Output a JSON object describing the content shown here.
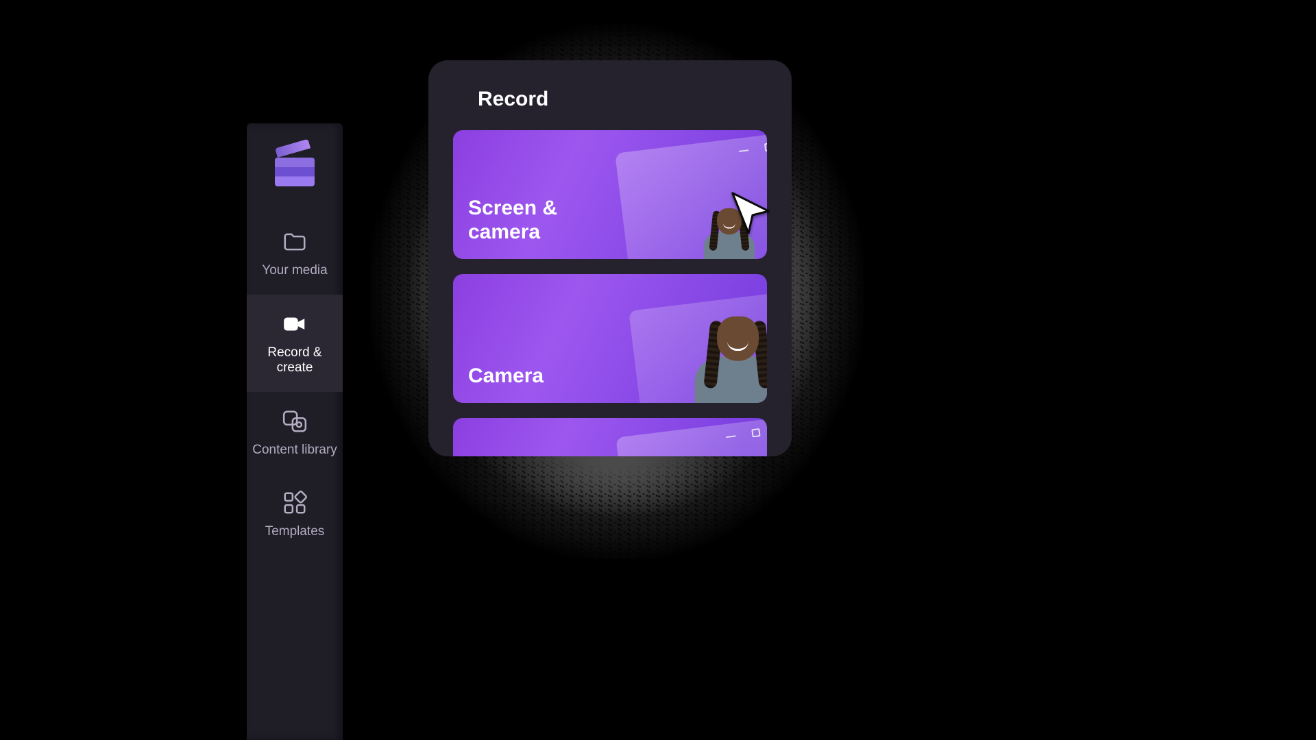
{
  "sidebar": {
    "items": [
      {
        "label": "Your media"
      },
      {
        "label": "Record & create"
      },
      {
        "label": "Content library"
      },
      {
        "label": "Templates"
      }
    ],
    "active_index": 1
  },
  "panel": {
    "title": "Record",
    "cards": [
      {
        "title": "Screen & camera"
      },
      {
        "title": "Camera"
      }
    ]
  },
  "colors": {
    "panel_bg": "#25222e",
    "sidebar_bg": "#1f1d26",
    "card_gradient_from": "#8b3fe0",
    "card_gradient_to": "#7a3fe0"
  }
}
